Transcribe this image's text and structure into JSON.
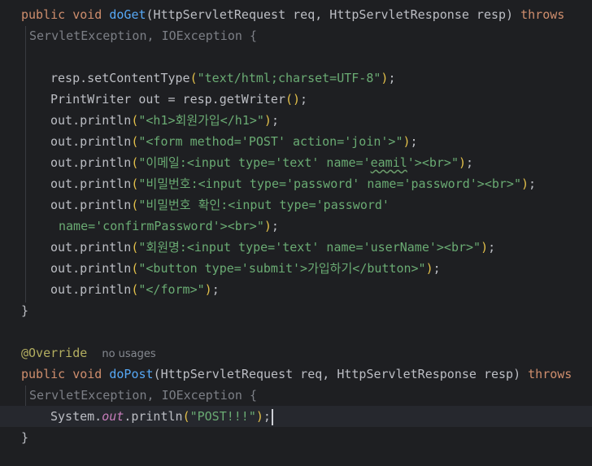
{
  "editor": {
    "lines": {
      "l1": {
        "mod": "public",
        "type": "void",
        "name": "doGet",
        "params": "(HttpServletRequest req, HttpServletResponse resp)",
        "throws": "throws"
      },
      "l2": {
        "exc1": "ServletException",
        "sep": ", ",
        "exc2": "IOException",
        "brace": "{"
      },
      "l4": {
        "pre": "resp.setContentType",
        "lp": "(",
        "str": "\"text/html;charset=UTF-8\"",
        "rp": ")",
        "semi": ";"
      },
      "l5": {
        "pre": "PrintWriter out = resp.getWriter",
        "parens": "()",
        "semi": ";"
      },
      "l6": {
        "pre": "out.println",
        "lp": "(",
        "str": "\"<h1>회원가입</h1>\"",
        "rp": ")",
        "semi": ";"
      },
      "l7": {
        "pre": "out.println",
        "lp": "(",
        "str": "\"<form method='POST' action='join'>\"",
        "rp": ")",
        "semi": ";"
      },
      "l8": {
        "pre": "out.println",
        "lp": "(",
        "str_a": "\"이메일:<input type='text' name='",
        "typo": "eamil",
        "str_b": "'><br>\"",
        "rp": ")",
        "semi": ";"
      },
      "l9": {
        "pre": "out.println",
        "lp": "(",
        "str": "\"비밀번호:<input type='password' name='password'><br>\"",
        "rp": ")",
        "semi": ";"
      },
      "l10": {
        "pre": "out.println",
        "lp": "(",
        "str": "\"비밀번호 확인:<input type='password'"
      },
      "l11": {
        "str": "name='confirmPassword'><br>\"",
        "rp": ")",
        "semi": ";"
      },
      "l12": {
        "pre": "out.println",
        "lp": "(",
        "str": "\"회원명:<input type='text' name='userName'><br>\"",
        "rp": ")",
        "semi": ";"
      },
      "l13": {
        "pre": "out.println",
        "lp": "(",
        "str": "\"<button type='submit'>가입하기</button>\"",
        "rp": ")",
        "semi": ";"
      },
      "l14": {
        "pre": "out.println",
        "lp": "(",
        "str": "\"</form>\"",
        "rp": ")",
        "semi": ";"
      },
      "l15": {
        "brace": "}"
      },
      "l17": {
        "ann": "@Override",
        "hint": "no usages"
      },
      "l18": {
        "mod": "public",
        "type": "void",
        "name": "doPost",
        "params": "(HttpServletRequest req, HttpServletResponse resp)",
        "throws": "throws"
      },
      "l19": {
        "exc1": "ServletException",
        "sep": ", ",
        "exc2": "IOException",
        "brace": "{"
      },
      "l20": {
        "obj": "System.",
        "field": "out",
        "call": ".println",
        "lp": "(",
        "str": "\"POST!!!\"",
        "rp": ")",
        "semi": ";"
      },
      "l21": {
        "brace": "}"
      }
    }
  }
}
